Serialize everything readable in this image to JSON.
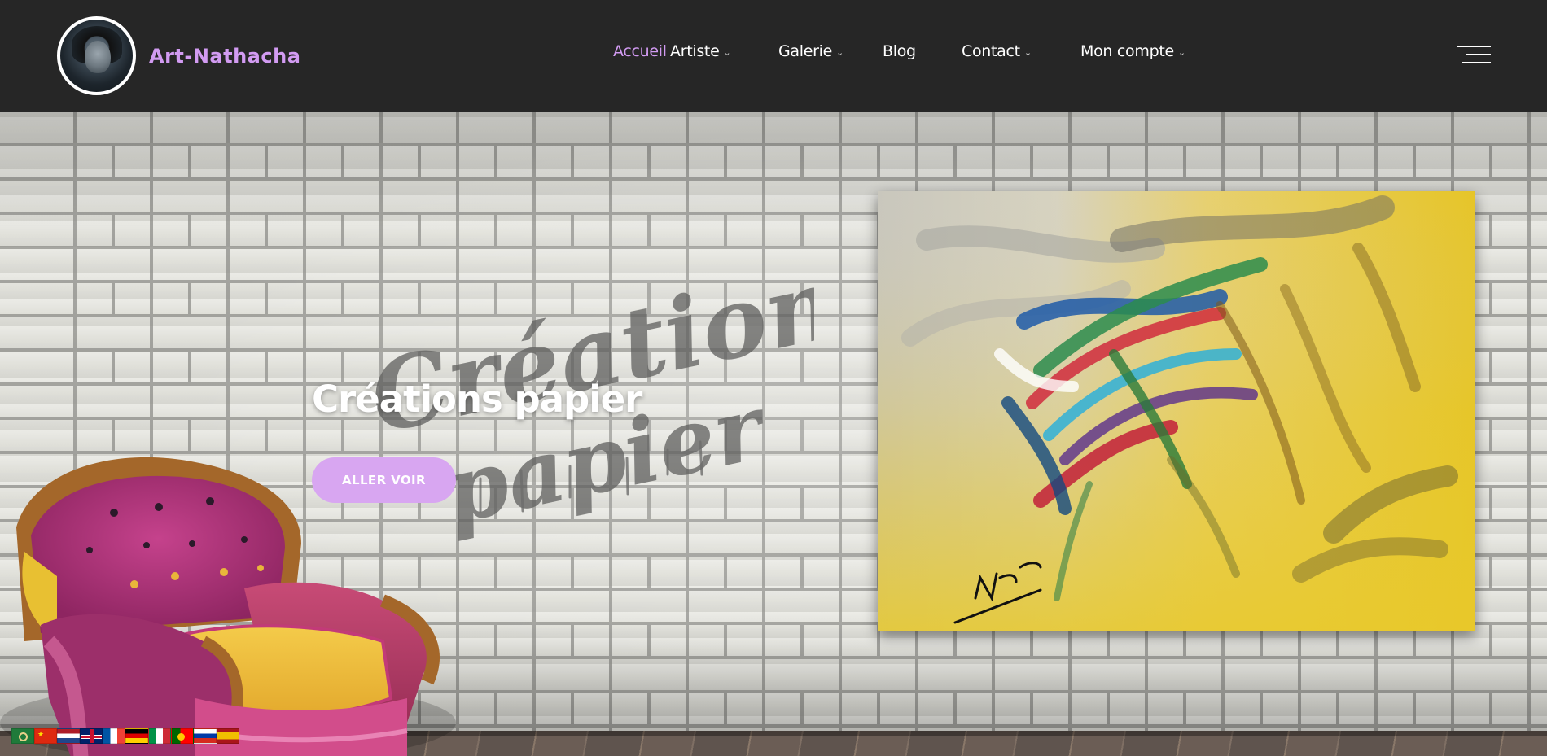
{
  "header": {
    "brand": "Art-Nathacha",
    "nav": [
      {
        "label": "Accueil",
        "active": true,
        "dropdown": false
      },
      {
        "label": "Artiste",
        "active": false,
        "dropdown": true
      },
      {
        "label": "Galerie",
        "active": false,
        "dropdown": true
      },
      {
        "label": "Blog",
        "active": false,
        "dropdown": false
      },
      {
        "label": "Contact",
        "active": false,
        "dropdown": true
      },
      {
        "label": "Mon compte",
        "active": false,
        "dropdown": true
      }
    ],
    "menu_icon": "hamburger-menu-icon"
  },
  "hero": {
    "title": "Créations papier",
    "button_label": "ALLER VOIR",
    "graffiti_text_line1": "Créations",
    "graffiti_text_line2": "papier",
    "painting_signature": "N.J."
  },
  "languages": [
    "Arabic",
    "Chinese",
    "Dutch",
    "English",
    "French",
    "German",
    "Italian",
    "Portuguese",
    "Russian",
    "Spanish"
  ],
  "colors": {
    "header_bg": "#262626",
    "accent": "#d29bf2",
    "button_bg": "#d8a6f1",
    "text_light": "#ffffff"
  }
}
